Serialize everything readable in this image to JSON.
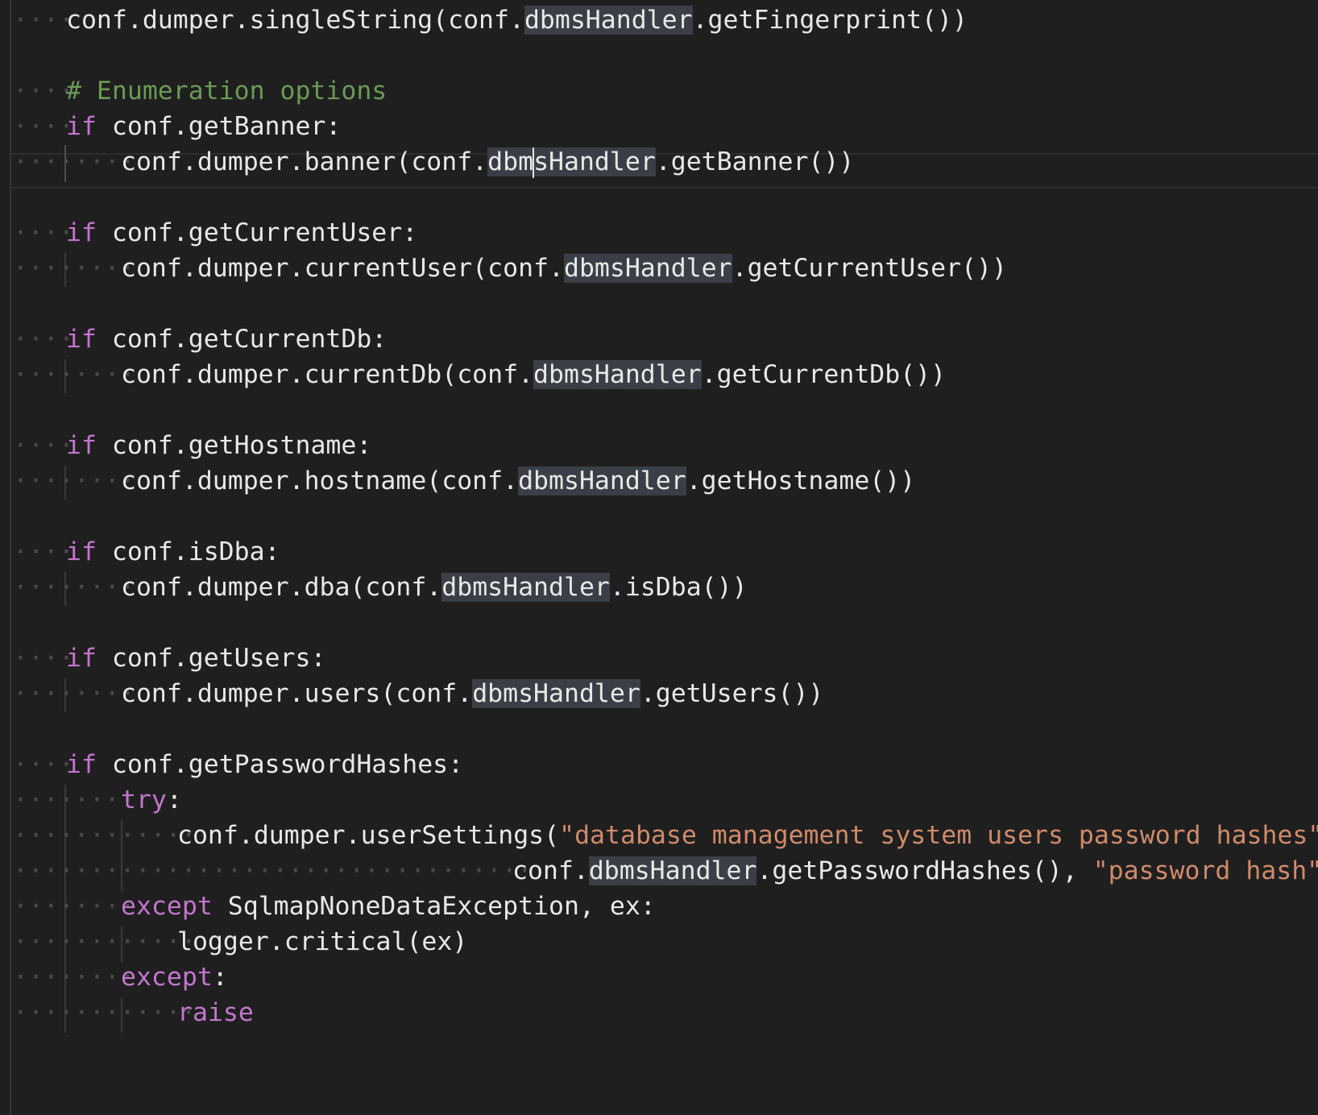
{
  "editor": {
    "language": "python",
    "colors": {
      "background": "#1f1f1f",
      "text": "#e8e8e8",
      "keyword": "#c475cf",
      "comment": "#6a9a55",
      "string": "#d08a6a",
      "selection_highlight": "#3a3f47",
      "whitespace_dots": "#4a4a4a"
    },
    "highlighted_word": "dbmsHandler",
    "lines": {
      "l1": {
        "ws": "····",
        "a": "conf.dumper.singleString(conf.",
        "hl": "dbmsHandler",
        "b": ".getFingerprint())"
      },
      "l3": {
        "ws": "····",
        "comment": "# Enumeration options"
      },
      "l4": {
        "ws": "····",
        "kw": "if",
        "a": " conf.getBanner:"
      },
      "l5": {
        "ws": "········",
        "a": "conf.dumper.banner(conf.",
        "hl1": "dbm",
        "hl2": "sHandler",
        "b": ".getBanner())"
      },
      "l7": {
        "ws": "····",
        "kw": "if",
        "a": " conf.getCurrentUser:"
      },
      "l8": {
        "ws": "········",
        "a": "conf.dumper.currentUser(conf.",
        "hl": "dbmsHandler",
        "b": ".getCurrentUser())"
      },
      "l10": {
        "ws": "····",
        "kw": "if",
        "a": " conf.getCurrentDb:"
      },
      "l11": {
        "ws": "········",
        "a": "conf.dumper.currentDb(conf.",
        "hl": "dbmsHandler",
        "b": ".getCurrentDb())"
      },
      "l13": {
        "ws": "····",
        "kw": "if",
        "a": " conf.getHostname:"
      },
      "l14": {
        "ws": "········",
        "a": "conf.dumper.hostname(conf.",
        "hl": "dbmsHandler",
        "b": ".getHostname())"
      },
      "l16": {
        "ws": "····",
        "kw": "if",
        "a": " conf.isDba:"
      },
      "l17": {
        "ws": "········",
        "a": "conf.dumper.dba(conf.",
        "hl": "dbmsHandler",
        "b": ".isDba())"
      },
      "l19": {
        "ws": "····",
        "kw": "if",
        "a": " conf.getUsers:"
      },
      "l20": {
        "ws": "········",
        "a": "conf.dumper.users(conf.",
        "hl": "dbmsHandler",
        "b": ".getUsers())"
      },
      "l22": {
        "ws": "····",
        "kw": "if",
        "a": " conf.getPasswordHashes:"
      },
      "l23": {
        "ws": "········",
        "kw": "try",
        "a": ":"
      },
      "l24": {
        "ws": "············",
        "a": "conf.dumper.userSettings(",
        "str": "\"database management system users password hashes\"",
        "b": ","
      },
      "l25": {
        "ws": "····································",
        "a": "conf.",
        "hl": "dbmsHandler",
        "b": ".getPasswordHashes(), ",
        "str": "\"password hash\"",
        "c": ","
      },
      "l26": {
        "ws": "········",
        "kw": "except",
        "a": " SqlmapNoneDataException, ex:"
      },
      "l27": {
        "ws": "············",
        "a": "logger.critical(ex)"
      },
      "l28": {
        "ws": "········",
        "kw": "except",
        "a": ":"
      },
      "l29": {
        "ws": "············",
        "kw": "raise"
      }
    }
  }
}
